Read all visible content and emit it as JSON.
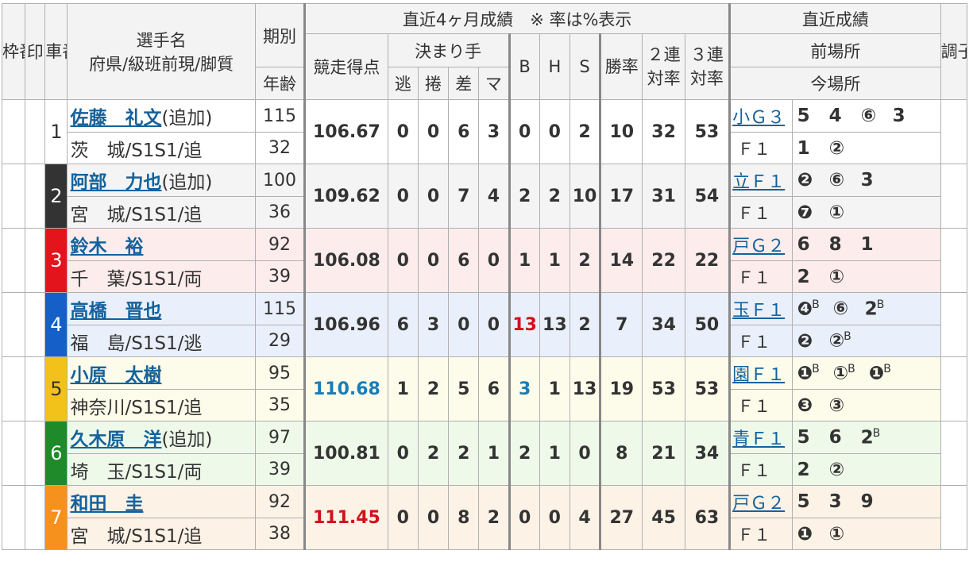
{
  "headers": {
    "waku": "枠番",
    "mark": "印",
    "car": "車番",
    "player_name": "選手名",
    "player_sub": "府県/級班前現/脚質",
    "period": "期別",
    "age": "年齢",
    "recent_4m": "直近4ヶ月成績　※ 率は%表示",
    "score": "競走得点",
    "kimarite": "決まり手",
    "nige": "逃",
    "makuri": "捲",
    "sashi": "差",
    "ma": "マ",
    "b": "B",
    "h": "H",
    "s": "S",
    "win_rate": "勝率",
    "ren2": "２連対率",
    "ren3": "３連対率",
    "recent_results": "直近成績",
    "prev_venue": "前場所",
    "this_venue": "今場所",
    "condition": "調子"
  },
  "colors": {
    "text": "#333333",
    "link": "#14629c",
    "red_highlight": "#d0121b",
    "blue_highlight": "#1b7db5"
  },
  "riders": [
    {
      "car": "1",
      "name": "佐藤　礼文",
      "added": "(追加)",
      "pref_class": "茨　城/S1S1/追",
      "period": "115",
      "age": "32",
      "score": "106.67",
      "nige": "0",
      "makuri": "0",
      "sashi": "6",
      "ma": "3",
      "b": "0",
      "h": "0",
      "s": "2",
      "win": "10",
      "r2": "32",
      "r3": "53",
      "prev_venue": "小Ｇ３",
      "today_venue": "Ｆ１",
      "prev_results": [
        {
          "v": "5"
        },
        {
          "v": "4"
        },
        {
          "v": "⑥"
        },
        {
          "v": "3"
        }
      ],
      "today_results": [
        {
          "v": "1"
        },
        {
          "v": "②"
        }
      ],
      "row_bg": "#ffffff",
      "car_bg": "#ffffff",
      "car_fg": "#333333",
      "score_color": "#333333",
      "b_color": "#333333"
    },
    {
      "car": "2",
      "name": "阿部　力也",
      "added": "(追加)",
      "pref_class": "宮　城/S1S1/追",
      "period": "100",
      "age": "36",
      "score": "109.62",
      "nige": "0",
      "makuri": "0",
      "sashi": "7",
      "ma": "4",
      "b": "2",
      "h": "2",
      "s": "10",
      "win": "17",
      "r2": "31",
      "r3": "54",
      "prev_venue": "立Ｆ１",
      "today_venue": "Ｆ１",
      "prev_results": [
        {
          "v": "❷"
        },
        {
          "v": "⑥"
        },
        {
          "v": "3"
        }
      ],
      "today_results": [
        {
          "v": "❼"
        },
        {
          "v": "①"
        }
      ],
      "row_bg": "#f4f4f4",
      "car_bg": "#333333",
      "car_fg": "#ffffff",
      "score_color": "#333333",
      "b_color": "#333333"
    },
    {
      "car": "3",
      "name": "鈴木　裕",
      "added": "",
      "pref_class": "千　葉/S1S1/両",
      "period": "92",
      "age": "39",
      "score": "106.08",
      "nige": "0",
      "makuri": "0",
      "sashi": "6",
      "ma": "0",
      "b": "1",
      "h": "1",
      "s": "2",
      "win": "14",
      "r2": "22",
      "r3": "22",
      "prev_venue": "戸Ｇ２",
      "today_venue": "Ｆ１",
      "prev_results": [
        {
          "v": "6"
        },
        {
          "v": "8"
        },
        {
          "v": "1"
        }
      ],
      "today_results": [
        {
          "v": "2"
        },
        {
          "v": "①"
        }
      ],
      "row_bg": "#fdecec",
      "car_bg": "#e3141c",
      "car_fg": "#ffffff",
      "score_color": "#333333",
      "b_color": "#333333"
    },
    {
      "car": "4",
      "name": "高橋　晋也",
      "added": "",
      "pref_class": "福　島/S1S1/逃",
      "period": "115",
      "age": "29",
      "score": "106.96",
      "nige": "6",
      "makuri": "3",
      "sashi": "0",
      "ma": "0",
      "b": "13",
      "h": "13",
      "s": "2",
      "win": "7",
      "r2": "34",
      "r3": "50",
      "prev_venue": "玉Ｆ１",
      "today_venue": "Ｆ１",
      "prev_results": [
        {
          "v": "❹",
          "sup": "B"
        },
        {
          "v": "⑥"
        },
        {
          "v": "2",
          "sup": "B"
        }
      ],
      "today_results": [
        {
          "v": "❷"
        },
        {
          "v": "②",
          "sup": "B"
        }
      ],
      "row_bg": "#eaf0fb",
      "car_bg": "#1460c8",
      "car_fg": "#ffffff",
      "score_color": "#333333",
      "b_color": "#d0121b"
    },
    {
      "car": "5",
      "name": "小原　太樹",
      "added": "",
      "pref_class": "神奈川/S1S1/追",
      "period": "95",
      "age": "35",
      "score": "110.68",
      "nige": "1",
      "makuri": "2",
      "sashi": "5",
      "ma": "6",
      "b": "3",
      "h": "1",
      "s": "13",
      "win": "19",
      "r2": "53",
      "r3": "53",
      "prev_venue": "園Ｆ１",
      "today_venue": "Ｆ１",
      "prev_results": [
        {
          "v": "❶",
          "sup": "B"
        },
        {
          "v": "①",
          "sup": "B"
        },
        {
          "v": "❶",
          "sup": "B"
        }
      ],
      "today_results": [
        {
          "v": "❸"
        },
        {
          "v": "③"
        }
      ],
      "row_bg": "#fdfbea",
      "car_bg": "#f2c21b",
      "car_fg": "#333333",
      "score_color": "#1b7db5",
      "b_color": "#1b7db5"
    },
    {
      "car": "6",
      "name": "久木原　洋",
      "added": "(追加)",
      "pref_class": "埼　玉/S1S1/両",
      "period": "97",
      "age": "39",
      "score": "100.81",
      "nige": "0",
      "makuri": "2",
      "sashi": "2",
      "ma": "1",
      "b": "2",
      "h": "1",
      "s": "0",
      "win": "8",
      "r2": "21",
      "r3": "34",
      "prev_venue": "青Ｆ１",
      "today_venue": "Ｆ１",
      "prev_results": [
        {
          "v": "5"
        },
        {
          "v": "6"
        },
        {
          "v": "2",
          "sup": "B"
        }
      ],
      "today_results": [
        {
          "v": "2"
        },
        {
          "v": "②"
        }
      ],
      "row_bg": "#eef9ea",
      "car_bg": "#1e8a2a",
      "car_fg": "#ffffff",
      "score_color": "#333333",
      "b_color": "#333333"
    },
    {
      "car": "7",
      "name": "和田　圭",
      "added": "",
      "pref_class": "宮　城/S1S1/追",
      "period": "92",
      "age": "38",
      "score": "111.45",
      "nige": "0",
      "makuri": "0",
      "sashi": "8",
      "ma": "2",
      "b": "0",
      "h": "0",
      "s": "4",
      "win": "27",
      "r2": "45",
      "r3": "63",
      "prev_venue": "戸Ｇ２",
      "today_venue": "Ｆ１",
      "prev_results": [
        {
          "v": "5"
        },
        {
          "v": "3"
        },
        {
          "v": "9"
        }
      ],
      "today_results": [
        {
          "v": "❶"
        },
        {
          "v": "①"
        }
      ],
      "row_bg": "#fdf2e6",
      "car_bg": "#f7911e",
      "car_fg": "#ffffff",
      "score_color": "#d0121b",
      "b_color": "#333333"
    }
  ]
}
